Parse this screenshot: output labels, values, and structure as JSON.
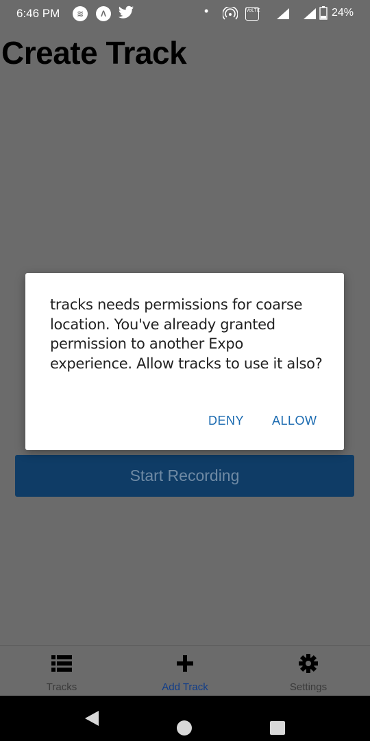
{
  "status_bar": {
    "time": "6:46 PM",
    "battery": "24%",
    "icons": [
      "spotify-icon",
      "expo-icon",
      "twitter-icon",
      "dot-icon",
      "hotspot-icon",
      "volte-icon",
      "signal-icon",
      "battery-icon"
    ],
    "volte_label": "VoLTE"
  },
  "page": {
    "title": "Create Track"
  },
  "start_button": {
    "label": "Start Recording"
  },
  "dialog": {
    "message": "tracks needs permissions for coarse location. You've already granted permission to another Expo experience. Allow tracks to use it also?",
    "deny_label": "DENY",
    "allow_label": "ALLOW"
  },
  "tabs": [
    {
      "label": "Tracks",
      "icon": "list-icon",
      "active": false
    },
    {
      "label": "Add Track",
      "icon": "plus-icon",
      "active": true
    },
    {
      "label": "Settings",
      "icon": "gear-icon",
      "active": false
    }
  ],
  "colors": {
    "accent": "#0f3c66",
    "dialog_action": "#1a6ab0",
    "active_tab": "#0f3c8a"
  }
}
